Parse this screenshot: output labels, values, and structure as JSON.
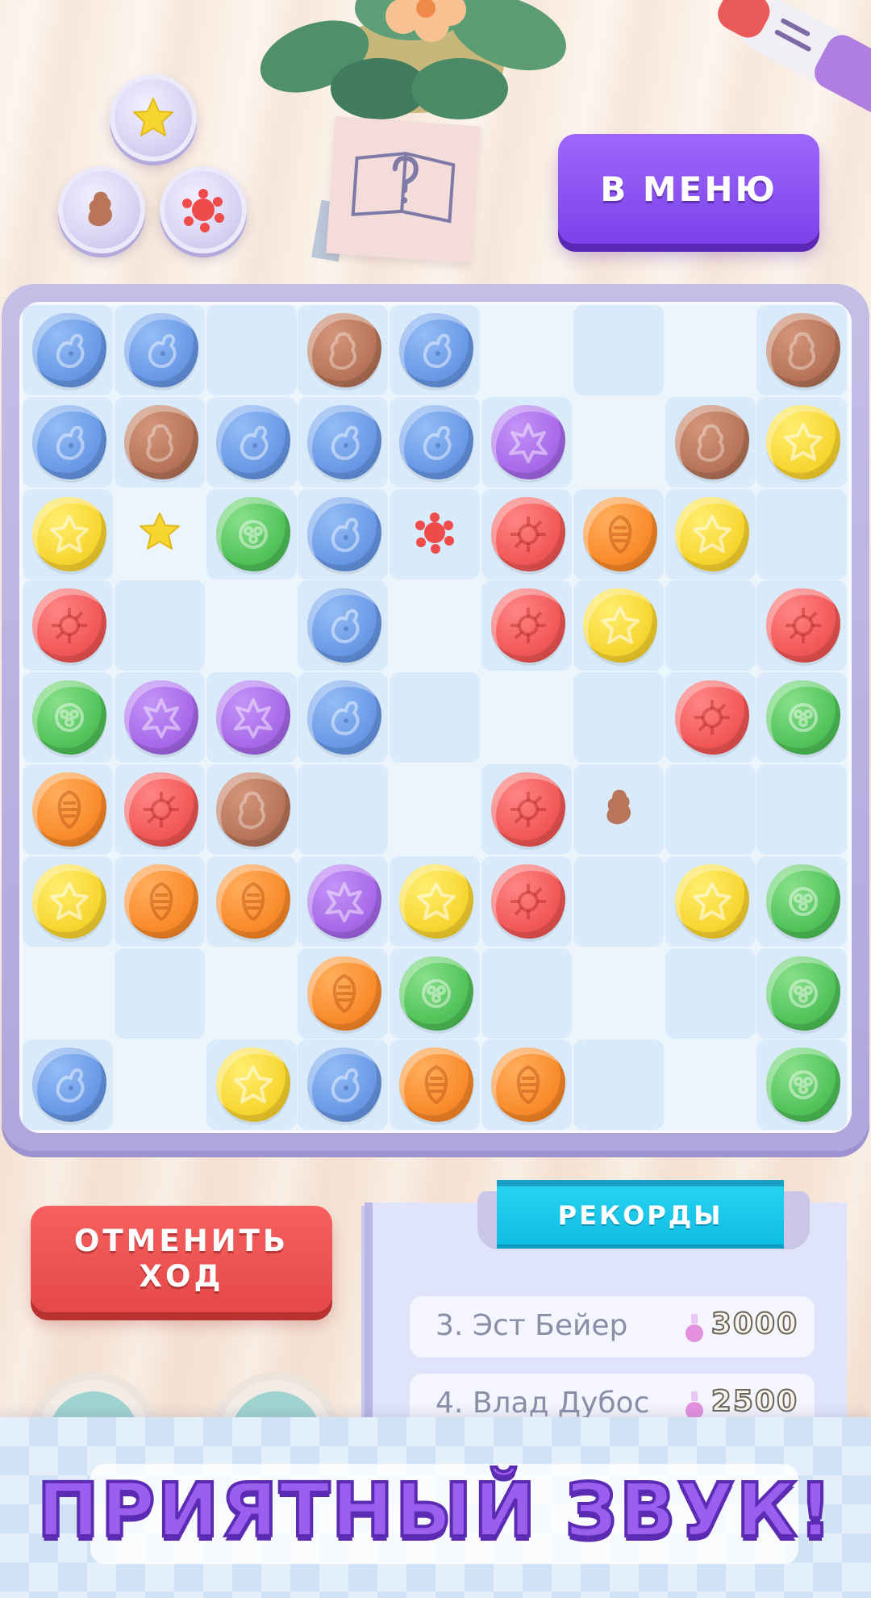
{
  "menu_button": {
    "label": "В МЕНЮ"
  },
  "undo_button": {
    "line1": "ОТМЕНИТЬ",
    "line2": "ХОД"
  },
  "records": {
    "title": "РЕКОРДЫ",
    "rows": [
      {
        "rank": "3.",
        "name": "Эст Бейер",
        "score": "3000"
      },
      {
        "rank": "4.",
        "name": "Влад Дубос",
        "score": "2500"
      }
    ]
  },
  "promo": {
    "text": "ПРИЯТНЫЙ ЗВУК!"
  },
  "collected_badges": [
    "yellow-star",
    "brown-bear",
    "red-splat"
  ],
  "board": {
    "rows": 9,
    "cols": 9,
    "tiles": [
      [
        1,
        1,
        1,
        1,
        1,
        0,
        1,
        0,
        1
      ],
      [
        1,
        1,
        1,
        1,
        1,
        1,
        0,
        1,
        1
      ],
      [
        1,
        0,
        1,
        1,
        1,
        1,
        1,
        1,
        1
      ],
      [
        1,
        1,
        0,
        1,
        0,
        1,
        1,
        1,
        1
      ],
      [
        1,
        1,
        1,
        1,
        1,
        0,
        1,
        1,
        1
      ],
      [
        1,
        1,
        1,
        1,
        0,
        1,
        1,
        1,
        1
      ],
      [
        1,
        1,
        1,
        1,
        1,
        1,
        1,
        1,
        1
      ],
      [
        0,
        1,
        0,
        1,
        1,
        1,
        0,
        1,
        1
      ],
      [
        1,
        0,
        1,
        1,
        1,
        1,
        1,
        0,
        1
      ]
    ],
    "pieces": [
      [
        "blue",
        "blue",
        "",
        "brown",
        "blue",
        "",
        "",
        "",
        "brown"
      ],
      [
        "blue",
        "brown",
        "blue",
        "blue",
        "blue",
        "purple",
        "",
        "brown",
        "yellow"
      ],
      [
        "yellow",
        "mini-yellow-star",
        "green",
        "blue",
        "mini-red-splat",
        "red",
        "orange",
        "yellow",
        ""
      ],
      [
        "red",
        "",
        "",
        "blue",
        "",
        "red",
        "yellow",
        "",
        "red"
      ],
      [
        "green",
        "purple",
        "purple",
        "blue",
        "",
        "",
        "",
        "red",
        "green"
      ],
      [
        "orange",
        "red",
        "brown",
        "",
        "",
        "red",
        "mini-brown-bear",
        "",
        ""
      ],
      [
        "yellow",
        "orange",
        "orange",
        "purple",
        "yellow",
        "red",
        "",
        "yellow",
        "green"
      ],
      [
        "",
        "",
        "",
        "orange",
        "green",
        "",
        "",
        "",
        "green"
      ],
      [
        "blue",
        "",
        "yellow",
        "blue",
        "orange",
        "orange",
        "",
        "",
        "green"
      ]
    ]
  },
  "colors": {
    "blue": "#6a99e6",
    "brown": "#b8755a",
    "purple": "#a86ae9",
    "yellow": "#f7d632",
    "green": "#52c35a",
    "red": "#f25858",
    "orange": "#f98b2c",
    "menu_button": "#8a52f3",
    "undo_button": "#ec5050",
    "records_header": "#16c4e8"
  }
}
